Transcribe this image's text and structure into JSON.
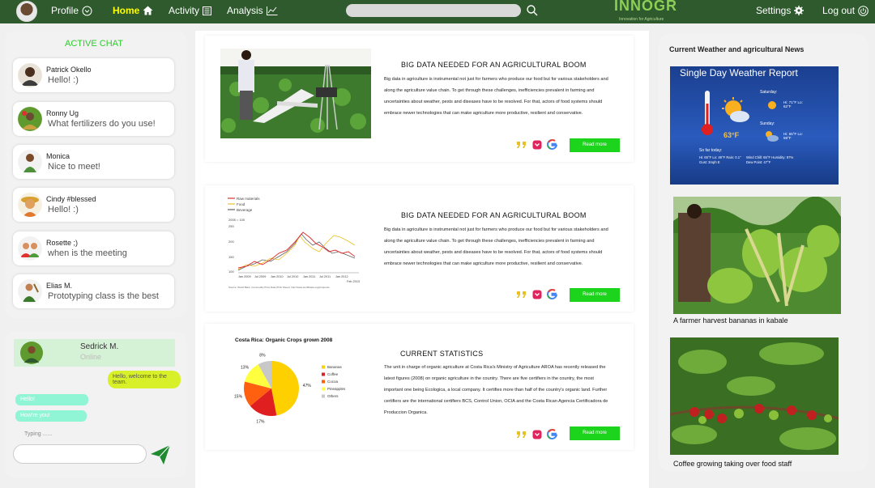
{
  "nav": {
    "profile": "Profile",
    "home": "Home",
    "activity": "Activity",
    "analysis": "Analysis",
    "logo": "INNOGR",
    "logo_tagline": "Innovation for Agriculture",
    "settings": "Settings",
    "logout": "Log out"
  },
  "chat": {
    "title": "ACTIVE CHAT",
    "contacts": [
      {
        "name": "Patrick Okello",
        "message": "Hello! :)"
      },
      {
        "name": "Ronny Ug",
        "message": "What fertilizers do you use!"
      },
      {
        "name": "Monica",
        "message": "Nice to meet!"
      },
      {
        "name": "Cindy #blessed",
        "message": "Hello! :)"
      },
      {
        "name": "Rosette ;)",
        "message": "when is the meeting"
      },
      {
        "name": "Elias M.",
        "message": "Prototyping class is the best"
      }
    ]
  },
  "conversation": {
    "name": "Sedrick M.",
    "status": "Online",
    "sent": "Hello, welcome to the team.",
    "received": [
      "Hello!",
      "How're you!"
    ],
    "typing": "Typing ......"
  },
  "articles": [
    {
      "title": "BIG DATA NEEDED FOR AN AGRICULTURAL BOOM",
      "body": "Big data in agriculture is instrumental not just for farmers who produce our food but for various stakeholders and along the agriculture value chain. To get through these challenges, inefficiencies prevalent in farming and uncertainties about weather, pests and diseases have to be resolved. For that, actors of food systems should embrace newer technologies that can make agriculture more productive, resilient and conservative.",
      "read_more": "Read more"
    },
    {
      "title": "BIG DATA NEEDED FOR AN AGRICULTURAL BOOM",
      "body": "Big data in agriculture is instrumental not just for farmers who produce our food but for various stakeholders and along the agriculture value chain. To get through these challenges, inefficiencies prevalent in farming and uncertainties about weather, pests and diseases have to be resolved. For that, actors of food systems should embrace newer technologies that can make agriculture more productive, resilient and conservative.",
      "read_more": "Read more"
    },
    {
      "title": "CURRENT STATISTICS",
      "body": "The unit in charge of organic agriculture at Costa Rica's Ministry of Agriculture AROA has recently released the latest figures (2008) on organic agriculture in the country. There are five certifiers in the country, the most important one being Ecologica, a local company. It certifies more than half of the country's organic land. Further certifiers are the international certifiers BCS, Control Union, OCIA and the Costa Rican Agencia Certificadora de Produccion Organica.",
      "read_more": "Read more"
    }
  ],
  "line_chart": {
    "legend": [
      "Raw materials",
      "Food",
      "Beverage"
    ],
    "ylabel": "2005 = 100",
    "yticks": [
      "250",
      "200",
      "150",
      "100"
    ],
    "xticks": [
      "Jan 2009",
      "Jul 2009",
      "Jan 2010",
      "Jul 2010",
      "Jan 2011",
      "Jul 2011",
      "Jan 2012",
      "Jul 2012",
      "Jan 2013",
      "Feb 2013"
    ],
    "source": "Source: World Bank, Commodity Price Data (Pink Sheet), http://www.worldbank.org/prospects",
    "colors": [
      "#e03030",
      "#e8c020",
      "#606060"
    ]
  },
  "chart_data": {
    "type": "pie",
    "title": "Costa Rica: Organic Crops grown 2008",
    "categories": [
      "Bananas",
      "Coffee",
      "Cocoa",
      "Pineapples",
      "Others"
    ],
    "values": [
      47,
      17,
      15,
      13,
      8
    ],
    "labels": [
      "47%",
      "17%",
      "15%",
      "13%",
      "8%"
    ],
    "colors": [
      "#ffd000",
      "#e02020",
      "#ff6010",
      "#ffff40",
      "#c8c8c8"
    ],
    "legend_position": "right"
  },
  "sidebar": {
    "title": "Current Weather and agricultural News",
    "weather": {
      "title": "Single Day Weather Report",
      "temp": "63°F",
      "saturday": "Saturday:",
      "sat_vals": "Hi: 71°F  Lo: 62°F",
      "sunday": "Sunday:",
      "sun_vals": "Hi: 65°F  Lo: 59°F",
      "so_far": "So far today:",
      "details": "Hi: 65°F Lo: 49°F  Rain: 0.1\"  Gust: 3mph E",
      "details2": "Wind Chill: 65°F  Humidity: 87%  Dew Point: 47°F"
    },
    "captions": [
      "A farmer harvest bananas in kabale",
      "Coffee growing taking over food staff"
    ]
  }
}
